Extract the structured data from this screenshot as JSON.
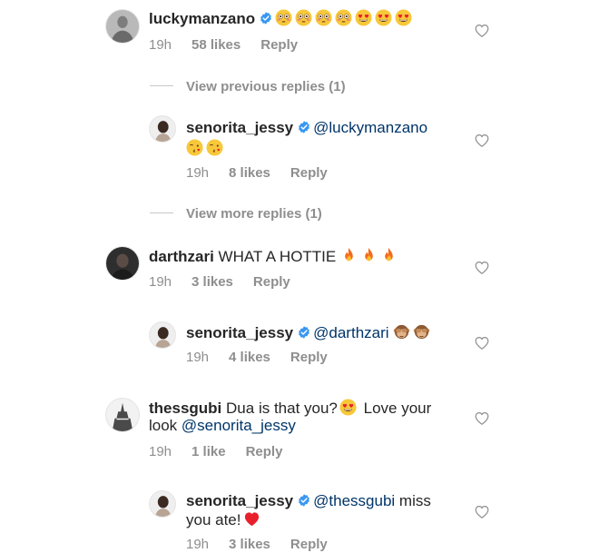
{
  "comments": [
    {
      "username": "luckymanzano",
      "text": "",
      "emojis": [
        "flushed-face",
        "flushed-face",
        "flushed-face",
        "flushed-face",
        "heart-eyes-face",
        "heart-eyes-face",
        "heart-eyes-face"
      ],
      "time": "19h",
      "likes": "58 likes",
      "reply": "Reply"
    },
    {
      "view_label": "View previous replies (1)"
    },
    {
      "username": "senorita_jessy",
      "mention": "@luckymanzano",
      "emojis": [
        "kissing-face",
        "kissing-face"
      ],
      "time": "19h",
      "likes": "8 likes",
      "reply": "Reply"
    },
    {
      "view_label": "View more replies (1)"
    },
    {
      "username": "darthzari",
      "text": "WHAT A HOTTIE",
      "emojis": [
        "fire",
        "fire",
        "fire"
      ],
      "time": "19h",
      "likes": "3 likes",
      "reply": "Reply"
    },
    {
      "username": "senorita_jessy",
      "mention": "@darthzari",
      "emojis": [
        "see-no-evil-monkey",
        "see-no-evil-monkey"
      ],
      "time": "19h",
      "likes": "4 likes",
      "reply": "Reply"
    },
    {
      "username": "thessgubi",
      "text": "Dua is that you?",
      "text2": "Love your",
      "text3": "look",
      "mention": "@senorita_jessy",
      "emojis": [
        "heart-eyes-face"
      ],
      "time": "19h",
      "likes": "1 like",
      "reply": "Reply"
    },
    {
      "username": "senorita_jessy",
      "mention": "@thessgubi",
      "text": "miss",
      "text2": "you ate!",
      "emojis": [
        "red-heart"
      ],
      "time": "19h",
      "likes": "3 likes",
      "reply": "Reply"
    }
  ],
  "colors": {
    "text": "#262626",
    "meta": "#8e8e8e",
    "mention": "#003569",
    "verified": "#3897f0"
  }
}
